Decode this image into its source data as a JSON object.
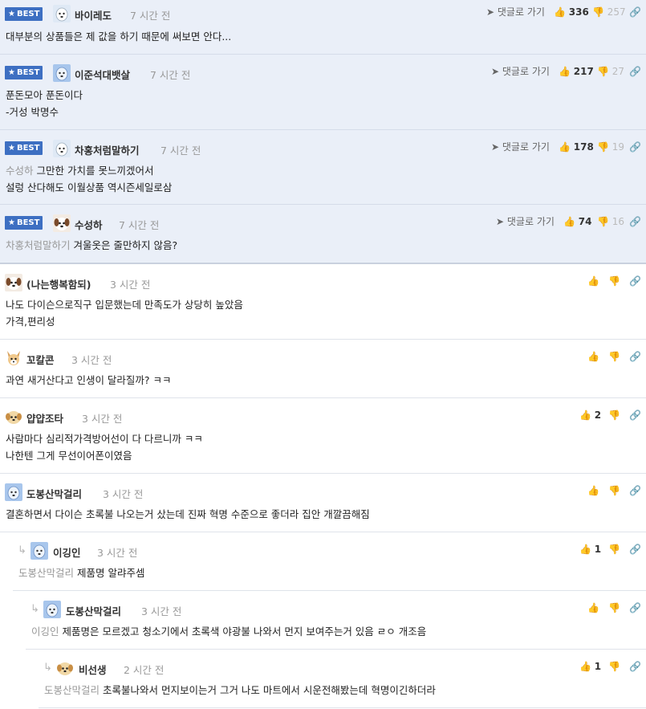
{
  "best_label": "BEST",
  "goto_label": "댓글로 가기",
  "comments": [
    {
      "kind": "best",
      "nick": "바이레도",
      "time": "7 시간 전",
      "goto": true,
      "up": "336",
      "down": "257",
      "mention": "",
      "lines": [
        "대부분의 상품들은 제 값을 하기 때문에 써보면 안다..."
      ],
      "avatar": "dog-white"
    },
    {
      "kind": "best",
      "nick": "이준석대뱃살",
      "time": "7 시간 전",
      "goto": true,
      "up": "217",
      "down": "27",
      "mention": "",
      "lines": [
        "푼돈모아 푼돈이다",
        "-거성 박명수"
      ],
      "avatar": "dog-blue"
    },
    {
      "kind": "best",
      "nick": "차홍처럼말하기",
      "time": "7 시간 전",
      "goto": true,
      "up": "178",
      "down": "19",
      "mention": "수성하",
      "lines": [
        "그만한 가치를 못느끼겠어서",
        "설렁 산다해도 이월상품 역시즌세일로삼"
      ],
      "avatar": "dog-white"
    },
    {
      "kind": "best",
      "nick": "수성하",
      "time": "7 시간 전",
      "goto": true,
      "up": "74",
      "down": "16",
      "mention": "차홍처럼말하기",
      "lines": [
        "겨울옷은 줄만하지 않음?"
      ],
      "avatar": "dog-brown"
    },
    {
      "kind": "normal",
      "nick": "(나는행복함되)",
      "time": "3 시간 전",
      "goto": false,
      "up": "",
      "down": "",
      "mention": "",
      "lines": [
        "나도 다이슨으로직구 입문했는데 만족도가 상당히 높았음",
        "가격,편리성"
      ],
      "avatar": "dog-brown"
    },
    {
      "kind": "normal",
      "nick": "꼬칼콘",
      "time": "3 시간 전",
      "goto": false,
      "up": "",
      "down": "",
      "mention": "",
      "lines": [
        "과연 새거산다고 인생이 달라질까? ㅋㅋ"
      ],
      "avatar": "dog-fox"
    },
    {
      "kind": "normal",
      "nick": "얍얍조타",
      "time": "3 시간 전",
      "goto": false,
      "up": "2",
      "down": "",
      "mention": "",
      "lines": [
        "사람마다 심리적가격방어선이 다 다르니까 ㅋㅋ",
        "나한텐 그게 무선이어폰이였음"
      ],
      "avatar": "dog-puppy"
    },
    {
      "kind": "normal",
      "nick": "도봉산막걸리",
      "time": "3 시간 전",
      "goto": false,
      "up": "",
      "down": "",
      "mention": "",
      "lines": [
        "결혼하면서 다이슨 초록불 나오는거 샀는데 진짜 혁명 수준으로 좋더라 집안 개깔끔해짐"
      ],
      "avatar": "dog-blue"
    },
    {
      "kind": "reply1",
      "nick": "이깅인",
      "time": "3 시간 전",
      "goto": false,
      "up": "1",
      "down": "",
      "mention": "도봉산막걸리",
      "lines": [
        "제품명 알랴주셈"
      ],
      "avatar": "dog-blue"
    },
    {
      "kind": "reply2",
      "nick": "도봉산막걸리",
      "time": "3 시간 전",
      "goto": false,
      "up": "",
      "down": "",
      "mention": "이깅인",
      "lines": [
        "제품명은 모르겠고 청소기에서 초록색 야광불 나와서 먼지 보여주는거 있음 ㄹㅇ 개조음"
      ],
      "avatar": "dog-blue"
    },
    {
      "kind": "reply3",
      "nick": "비선생",
      "time": "2 시간 전",
      "goto": false,
      "up": "1",
      "down": "",
      "mention": "도봉산막걸리",
      "lines": [
        "초록불나와서 먼지보이는거 그거 나도 마트에서 시운전해봤는데 혁명이긴하더라"
      ],
      "avatar": "dog-puppy"
    }
  ]
}
